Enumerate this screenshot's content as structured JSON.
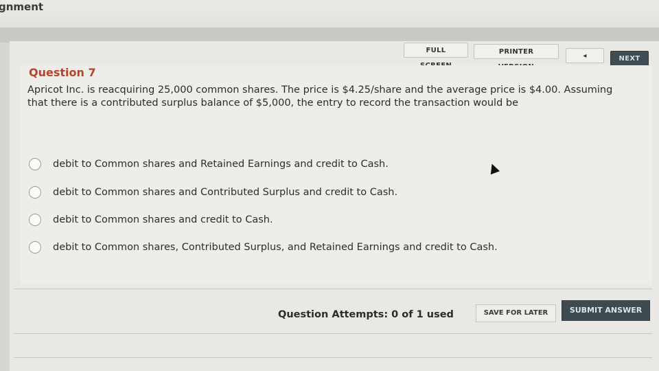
{
  "header": {
    "title": "gnment"
  },
  "toolbar": {
    "full_screen": "FULL SCREEN",
    "printer_version": "PRINTER VERSION",
    "back": "◂ BACK",
    "next": "NEXT ▸"
  },
  "question": {
    "title": "Question 7",
    "text": "Apricot Inc. is reacquiring 25,000 common shares. The price is $4.25/share and the average price is $4.00. Assuming that there is a contributed surplus balance of $5,000, the entry to record the transaction would be",
    "options": [
      "debit to Common shares and Retained Earnings and credit to Cash.",
      "debit to Common shares and Contributed Surplus and credit to Cash.",
      "debit to Common shares and credit to Cash.",
      "debit to Common shares, Contributed Surplus, and Retained Earnings and credit to Cash."
    ]
  },
  "footer": {
    "attempts": "Question Attempts: 0 of 1 used",
    "save_for_later": "SAVE FOR LATER",
    "submit_answer": "SUBMIT ANSWER"
  }
}
